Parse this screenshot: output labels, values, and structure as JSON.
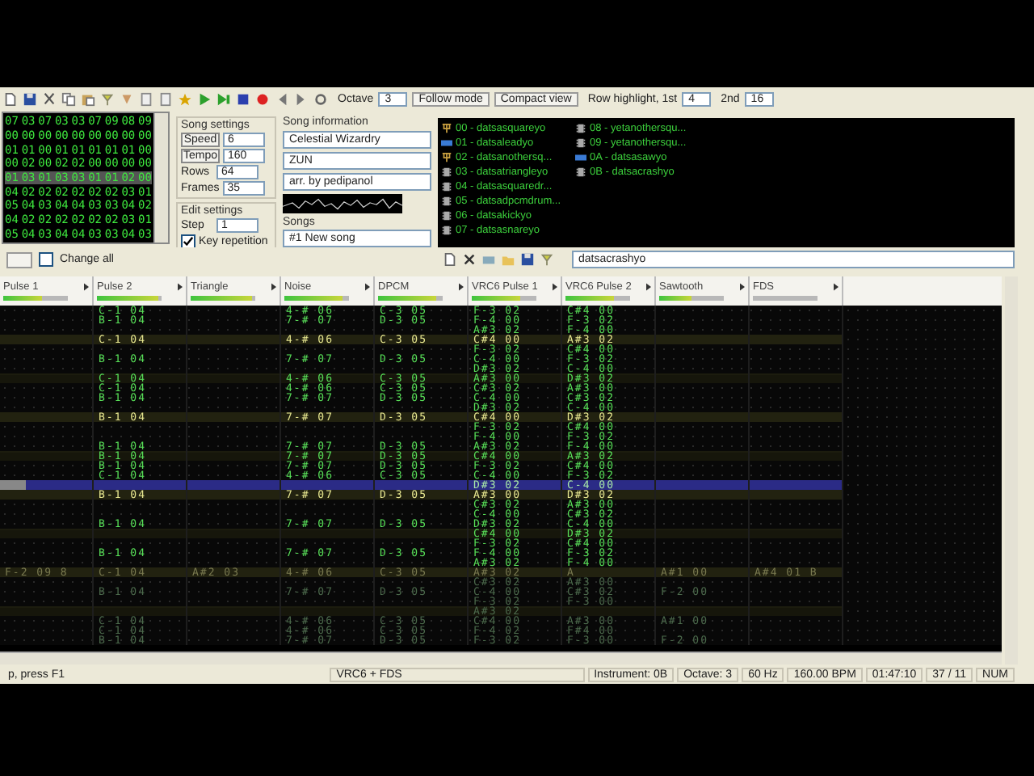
{
  "toolbar": {
    "octave_label": "Octave",
    "octave": "3",
    "follow_mode": "Follow mode",
    "compact_view": "Compact view",
    "highlight_1st_label": "Row highlight, 1st",
    "highlight_1st": "4",
    "highlight_2nd_label": "2nd",
    "highlight_2nd": "16"
  },
  "frames": [
    {
      "selected": false,
      "cells": [
        "07",
        "03",
        "07",
        "03",
        "03",
        "07",
        "09",
        "08",
        "09"
      ]
    },
    {
      "selected": false,
      "cells": [
        "00",
        "00",
        "00",
        "00",
        "00",
        "00",
        "00",
        "00",
        "00"
      ]
    },
    {
      "selected": false,
      "cells": [
        "01",
        "01",
        "00",
        "01",
        "01",
        "01",
        "01",
        "01",
        "00"
      ]
    },
    {
      "selected": false,
      "cells": [
        "00",
        "02",
        "00",
        "02",
        "02",
        "00",
        "00",
        "00",
        "00"
      ]
    },
    {
      "selected": true,
      "cells": [
        "01",
        "03",
        "01",
        "03",
        "03",
        "01",
        "01",
        "02",
        "00"
      ]
    },
    {
      "selected": false,
      "cells": [
        "04",
        "02",
        "02",
        "02",
        "02",
        "02",
        "02",
        "03",
        "01"
      ]
    },
    {
      "selected": false,
      "cells": [
        "05",
        "04",
        "03",
        "04",
        "04",
        "03",
        "03",
        "04",
        "02"
      ]
    },
    {
      "selected": false,
      "cells": [
        "04",
        "02",
        "02",
        "02",
        "02",
        "02",
        "02",
        "03",
        "01"
      ]
    },
    {
      "selected": false,
      "cells": [
        "05",
        "04",
        "03",
        "04",
        "04",
        "03",
        "03",
        "04",
        "03"
      ]
    }
  ],
  "song_settings": {
    "title": "Song settings",
    "fields": [
      {
        "label": "Speed",
        "value": "6",
        "kind": "button"
      },
      {
        "label": "Tempo",
        "value": "160",
        "kind": "button"
      },
      {
        "label": "Rows",
        "value": "64",
        "kind": "text"
      },
      {
        "label": "Frames",
        "value": "35",
        "kind": "text"
      }
    ]
  },
  "edit_settings": {
    "title": "Edit settings",
    "step_label": "Step",
    "step": "1",
    "key_repetition": {
      "label": "Key repetition",
      "checked": true
    }
  },
  "song_information": {
    "title": "Song information",
    "name": "Celestial Wizardry",
    "artist": "ZUN",
    "copyright": "arr. by pedipanol"
  },
  "songs": {
    "title": "Songs",
    "selected": "#1 New song"
  },
  "instruments": [
    {
      "label": "00 - datsasquareyo",
      "kind": "fork"
    },
    {
      "label": "01 - datsaleadyo",
      "kind": "badge"
    },
    {
      "label": "02 - datsanothersq...",
      "kind": "fork"
    },
    {
      "label": "03 - datsatriangleyo",
      "kind": "chip"
    },
    {
      "label": "04 - datsasquaredr...",
      "kind": "chip"
    },
    {
      "label": "05 - datsadpcmdrum...",
      "kind": "chip"
    },
    {
      "label": "06 - datsakickyo",
      "kind": "chip"
    },
    {
      "label": "07 - datsasnareyo",
      "kind": "chip"
    },
    {
      "label": "08 - yetanothersqu...",
      "kind": "chip"
    },
    {
      "label": "09 - yetanothersqu...",
      "kind": "chip"
    },
    {
      "label": "0A - datsasawyo",
      "kind": "badge"
    },
    {
      "label": "0B - datsacrashyo",
      "kind": "chip"
    }
  ],
  "instrument_name": "datsacrashyo",
  "change_all": {
    "label": "Change all",
    "checked": false
  },
  "channels": [
    {
      "name": "Pulse 1",
      "level": 0.6
    },
    {
      "name": "Pulse 2",
      "level": 0.95
    },
    {
      "name": "Triangle",
      "level": 0.95
    },
    {
      "name": "Noise",
      "level": 0.9
    },
    {
      "name": "DPCM",
      "level": 0.9
    },
    {
      "name": "VRC6 Pulse 1",
      "level": 0.75
    },
    {
      "name": "VRC6 Pulse 2",
      "level": 0.75
    },
    {
      "name": "Sawtooth",
      "level": 0.5
    },
    {
      "name": "FDS"
    }
  ],
  "pattern": [
    {
      "highlighted": false,
      "beat_highlighted": false,
      "dimmed": false,
      "selected": false,
      "cells": [
        null,
        "C-1 04",
        null,
        "4-# 06",
        "C-3 05",
        "F-3 02",
        "C#4 00",
        null,
        null
      ]
    },
    {
      "highlighted": false,
      "beat_highlighted": false,
      "dimmed": false,
      "selected": false,
      "cells": [
        null,
        "B-1 04",
        null,
        "7-# 07",
        "D-3 05",
        "F-4 00",
        "F-3 02",
        null,
        null
      ]
    },
    {
      "highlighted": false,
      "beat_highlighted": false,
      "dimmed": false,
      "selected": false,
      "cells": [
        null,
        null,
        null,
        null,
        null,
        "A#3 02",
        "F-4 00",
        null,
        null
      ]
    },
    {
      "highlighted": true,
      "beat_highlighted": false,
      "dimmed": false,
      "selected": false,
      "cells": [
        null,
        "C-1 04",
        null,
        "4-# 06",
        "C-3 05",
        "C#4 00",
        "A#3 02",
        null,
        null
      ]
    },
    {
      "highlighted": false,
      "beat_highlighted": false,
      "dimmed": false,
      "selected": false,
      "cells": [
        null,
        null,
        null,
        null,
        null,
        "F-3 02",
        "C#4 00",
        null,
        null
      ]
    },
    {
      "highlighted": false,
      "beat_highlighted": false,
      "dimmed": false,
      "selected": false,
      "cells": [
        null,
        "B-1 04",
        null,
        "7-# 07",
        "D-3 05",
        "C-4 00",
        "F-3 02",
        null,
        null
      ]
    },
    {
      "highlighted": false,
      "beat_highlighted": false,
      "dimmed": false,
      "selected": false,
      "cells": [
        null,
        null,
        null,
        null,
        null,
        "D#3 02",
        "C-4 00",
        null,
        null
      ]
    },
    {
      "highlighted": false,
      "beat_highlighted": true,
      "dimmed": false,
      "selected": false,
      "cells": [
        null,
        "C-1 04",
        null,
        "4-# 06",
        "C-3 05",
        "A#3 00",
        "D#3 02",
        null,
        null
      ]
    },
    {
      "highlighted": false,
      "beat_highlighted": false,
      "dimmed": false,
      "selected": false,
      "cells": [
        null,
        "C-1 04",
        null,
        "4-# 06",
        "C-3 05",
        "C#3 02",
        "A#3 00",
        null,
        null
      ]
    },
    {
      "highlighted": false,
      "beat_highlighted": false,
      "dimmed": false,
      "selected": false,
      "cells": [
        null,
        "B-1 04",
        null,
        "7-# 07",
        "D-3 05",
        "C-4 00",
        "C#3 02",
        null,
        null
      ]
    },
    {
      "highlighted": false,
      "beat_highlighted": false,
      "dimmed": false,
      "selected": false,
      "cells": [
        null,
        null,
        null,
        null,
        null,
        "D#3 02",
        "C-4 00",
        null,
        null
      ]
    },
    {
      "highlighted": true,
      "beat_highlighted": false,
      "dimmed": false,
      "selected": false,
      "cells": [
        null,
        "B-1 04",
        null,
        "7-# 07",
        "D-3 05",
        "C#4 00",
        "D#3 02",
        null,
        null
      ]
    },
    {
      "highlighted": false,
      "beat_highlighted": false,
      "dimmed": false,
      "selected": false,
      "cells": [
        null,
        null,
        null,
        null,
        null,
        "F-3 02",
        "C#4 00",
        null,
        null
      ]
    },
    {
      "highlighted": false,
      "beat_highlighted": false,
      "dimmed": false,
      "selected": false,
      "cells": [
        null,
        null,
        null,
        null,
        null,
        "F-4 00",
        "F-3 02",
        null,
        null
      ]
    },
    {
      "highlighted": false,
      "beat_highlighted": false,
      "dimmed": false,
      "selected": false,
      "cells": [
        null,
        "B-1 04",
        null,
        "7-# 07",
        "D-3 05",
        "A#3 02",
        "F-4 00",
        null,
        null
      ]
    },
    {
      "highlighted": false,
      "beat_highlighted": true,
      "dimmed": false,
      "selected": false,
      "cells": [
        null,
        "B-1 04",
        null,
        "7-# 07",
        "D-3 05",
        "C#4 00",
        "A#3 02",
        null,
        null
      ]
    },
    {
      "highlighted": false,
      "beat_highlighted": false,
      "dimmed": false,
      "selected": false,
      "cells": [
        null,
        "B-1 04",
        null,
        "7-# 07",
        "D-3 05",
        "F-3 02",
        "C#4 00",
        null,
        null
      ]
    },
    {
      "highlighted": false,
      "beat_highlighted": false,
      "dimmed": false,
      "selected": false,
      "cells": [
        null,
        "C-1 04",
        null,
        "4-# 06",
        "C-3 05",
        "C-4 00",
        "F-3 02",
        null,
        null
      ]
    },
    {
      "highlighted": false,
      "beat_highlighted": false,
      "dimmed": false,
      "selected": true,
      "cells": [
        null,
        null,
        null,
        null,
        null,
        "D#3 02",
        "C-4 00",
        null,
        null
      ]
    },
    {
      "highlighted": true,
      "beat_highlighted": false,
      "dimmed": false,
      "selected": false,
      "cells": [
        null,
        "B-1 04",
        null,
        "7-# 07",
        "D-3 05",
        "A#3 00",
        "D#3 02",
        null,
        null
      ]
    },
    {
      "highlighted": false,
      "beat_highlighted": false,
      "dimmed": false,
      "selected": false,
      "cells": [
        null,
        null,
        null,
        null,
        null,
        "C#3 02",
        "A#3 00",
        null,
        null
      ]
    },
    {
      "highlighted": false,
      "beat_highlighted": false,
      "dimmed": false,
      "selected": false,
      "cells": [
        null,
        null,
        null,
        null,
        null,
        "C-4 00",
        "C#3 02",
        null,
        null
      ]
    },
    {
      "highlighted": false,
      "beat_highlighted": false,
      "dimmed": false,
      "selected": false,
      "cells": [
        null,
        "B-1 04",
        null,
        "7-# 07",
        "D-3 05",
        "D#3 02",
        "C-4 00",
        null,
        null
      ]
    },
    {
      "highlighted": false,
      "beat_highlighted": true,
      "dimmed": false,
      "selected": false,
      "cells": [
        null,
        null,
        null,
        null,
        null,
        "C#4 00",
        "D#3 02",
        null,
        null
      ]
    },
    {
      "highlighted": false,
      "beat_highlighted": false,
      "dimmed": false,
      "selected": false,
      "cells": [
        null,
        null,
        null,
        null,
        null,
        "F-3 02",
        "C#4 00",
        null,
        null
      ]
    },
    {
      "highlighted": false,
      "beat_highlighted": false,
      "dimmed": false,
      "selected": false,
      "cells": [
        null,
        "B-1 04",
        null,
        "7-# 07",
        "D-3 05",
        "F-4 00",
        "F-3 02",
        null,
        null
      ]
    },
    {
      "highlighted": false,
      "beat_highlighted": false,
      "dimmed": false,
      "selected": false,
      "cells": [
        null,
        null,
        null,
        null,
        null,
        "A#3 02",
        "F-4 00",
        null,
        null
      ]
    },
    {
      "highlighted": true,
      "beat_highlighted": false,
      "dimmed": true,
      "selected": false,
      "cells": [
        "F-2 09 8",
        "C-1 04",
        "A#2 03",
        "4-# 06",
        "C-3 05",
        "A#3 02",
        "A",
        "A#1 00",
        "A#4 01 B"
      ]
    },
    {
      "highlighted": false,
      "beat_highlighted": false,
      "dimmed": true,
      "selected": false,
      "cells": [
        null,
        null,
        null,
        null,
        null,
        "C#3 02",
        "A#3 00",
        null,
        null
      ]
    },
    {
      "highlighted": false,
      "beat_highlighted": false,
      "dimmed": true,
      "selected": false,
      "cells": [
        null,
        "B-1 04",
        null,
        "7-# 07",
        "D-3 05",
        "C-4 00",
        "C#3 02",
        "F-2 00",
        null
      ]
    },
    {
      "highlighted": false,
      "beat_highlighted": false,
      "dimmed": true,
      "selected": false,
      "cells": [
        null,
        null,
        null,
        null,
        null,
        "F-3 02",
        "F-3 00",
        null,
        null
      ]
    },
    {
      "highlighted": false,
      "beat_highlighted": true,
      "dimmed": true,
      "selected": false,
      "cells": [
        null,
        null,
        null,
        null,
        null,
        "A#3 02",
        null,
        null,
        null
      ]
    },
    {
      "highlighted": false,
      "beat_highlighted": false,
      "dimmed": true,
      "selected": false,
      "cells": [
        null,
        "C-1 04",
        null,
        "4-# 06",
        "C-3 05",
        "C#4 00",
        "A#3 00",
        "A#1 00",
        null
      ]
    },
    {
      "highlighted": false,
      "beat_highlighted": false,
      "dimmed": true,
      "selected": false,
      "cells": [
        null,
        "C-1 04",
        null,
        "4-# 06",
        "C-3 05",
        "F-4 02",
        "F#4 00",
        null,
        null
      ]
    },
    {
      "highlighted": false,
      "beat_highlighted": false,
      "dimmed": true,
      "selected": false,
      "cells": [
        null,
        "B-1 04",
        null,
        "7-# 07",
        "D-3 05",
        "F-3 02",
        "F-3 00",
        "F-2 00",
        null
      ]
    }
  ],
  "status_bar": {
    "help": "p, press F1",
    "chip": "VRC6 + FDS",
    "instrument": "Instrument: 0B",
    "octave": "Octave: 3",
    "rate": "60 Hz",
    "tempo": "160.00 BPM",
    "time": "01:47:10",
    "position": "37 / 11",
    "num": "NUM"
  }
}
